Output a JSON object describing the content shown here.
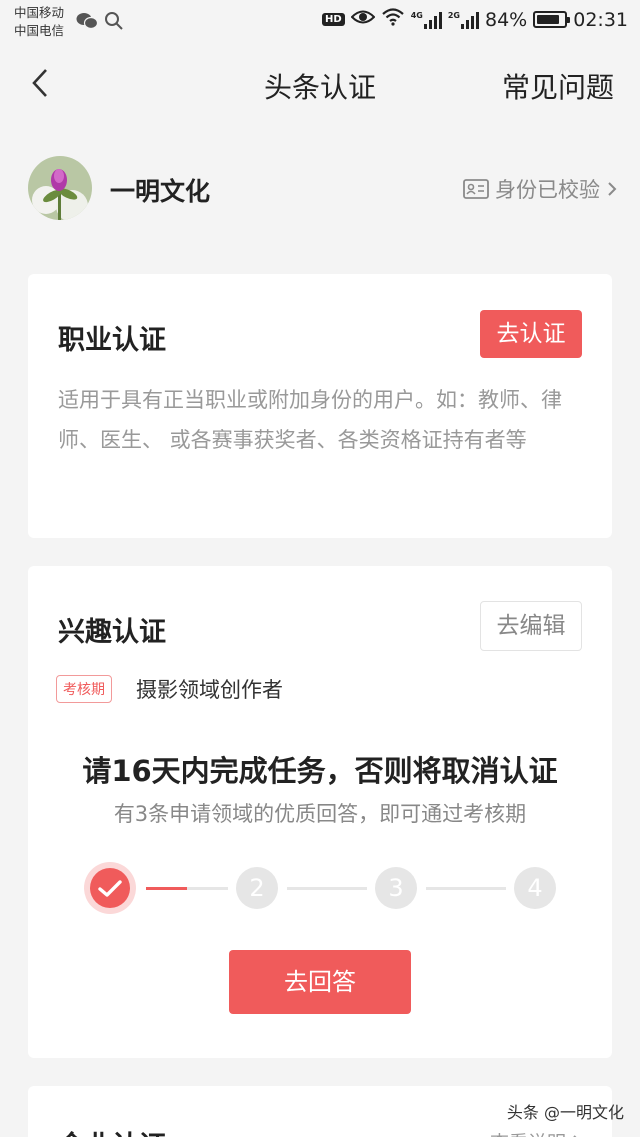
{
  "status_bar": {
    "carrier1": "中国移动",
    "carrier2": "中国电信",
    "hd": "HD",
    "net1": "4G",
    "net2": "2G",
    "battery": "84%",
    "battery_level": 0.84,
    "time": "02:31"
  },
  "nav": {
    "title": "头条认证",
    "faq": "常见问题"
  },
  "profile": {
    "name": "一明文化",
    "verified": "身份已校验"
  },
  "professional": {
    "title": "职业认证",
    "button": "去认证",
    "description": "适用于具有正当职业或附加身份的用户。如：教师、律师、医生、 或各赛事获奖者、各类资格证持有者等"
  },
  "interest": {
    "title": "兴趣认证",
    "edit_button": "去编辑",
    "tag": "考核期",
    "field": "摄影领域创作者",
    "headline": "请16天内完成任务，否则将取消认证",
    "subtitle": "有3条申请领域的优质回答，即可通过考核期",
    "steps": [
      "2",
      "3",
      "4"
    ],
    "first_segment_progress": 0.5,
    "answer_button": "去回答"
  },
  "enterprise": {
    "title": "企业认证",
    "link": "查看说明"
  },
  "watermark": "头条 @一明文化",
  "colors": {
    "accent": "#f05b5b",
    "background": "#f4f4f4",
    "card": "#ffffff"
  }
}
